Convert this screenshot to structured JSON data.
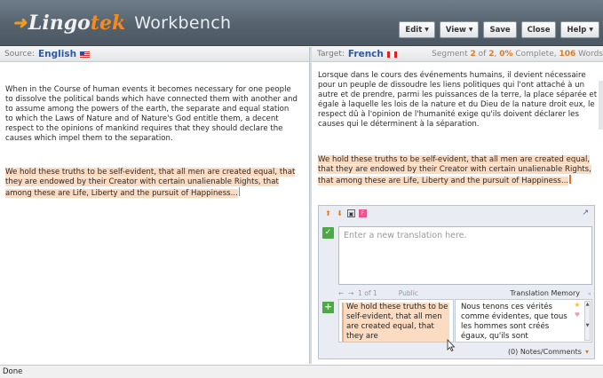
{
  "header": {
    "logo_text_main": "Lingo",
    "logo_text_accent": "tek",
    "product": "Workbench",
    "buttons": [
      {
        "label": "Edit",
        "has_menu": true
      },
      {
        "label": "View",
        "has_menu": true
      },
      {
        "label": "Save",
        "has_menu": false
      },
      {
        "label": "Close",
        "has_menu": false
      },
      {
        "label": "Help",
        "has_menu": true
      }
    ]
  },
  "source": {
    "label": "Source:",
    "language": "English",
    "flag": "us-flag-icon",
    "paragraphs": [
      "When in the Course of human events it becomes necessary for one people to dissolve the political bands which have connected them with another and to assume among the powers of the earth, the separate and equal station to which the Laws of Nature and of Nature's God entitle them, a decent respect to the opinions of mankind requires that they should declare the causes which impel them to the separation.",
      "We hold these truths to be self-evident, that all men are created equal, that they are endowed by their Creator with certain unalienable Rights, that among these are Life, Liberty and the pursuit of Happiness..."
    ]
  },
  "target": {
    "label": "Target:",
    "language": "French",
    "flag": "canada-flag-icon",
    "segment_prefix": "Segment",
    "segment_current": "2",
    "segment_of": "of",
    "segment_total": "2",
    "complete_pct": "0%",
    "complete_label": "Complete,",
    "word_count": "106",
    "word_label": "Words",
    "paragraphs": [
      "Lorsque dans le cours des événements humains, il devient nécessaire pour un peuple de dissoudre les liens politiques qui l'ont attaché à un autre et de prendre, parmi les puissances de la terre, la place séparée et égale à laquelle les lois de la nature et du Dieu de la nature droit eux, le respect dû à l'opinion de l'humanité exige qu'ils doivent déclarer les causes qui le déterminent à la séparation.",
      "We hold these truths to be self-evident, that all men are created equal, that they are endowed by their Creator with certain unalienable Rights, that among these are Life, Liberty and the pursuit of Happiness..."
    ]
  },
  "editor": {
    "placeholder": "Enter a new translation here.",
    "tm_nav": "1 of 1",
    "tm_visibility": "Public",
    "tm_label": "Translation Memory",
    "tm_source": "We hold these truths to be self-evident, that all men are created equal, that they are",
    "tm_target": "Nous tenons ces vérités comme évidentes, que tous les hommes sont créés égaux, qu'ils sont",
    "notes_label": "(0) Notes/Comments"
  },
  "status": {
    "text": "Done"
  }
}
